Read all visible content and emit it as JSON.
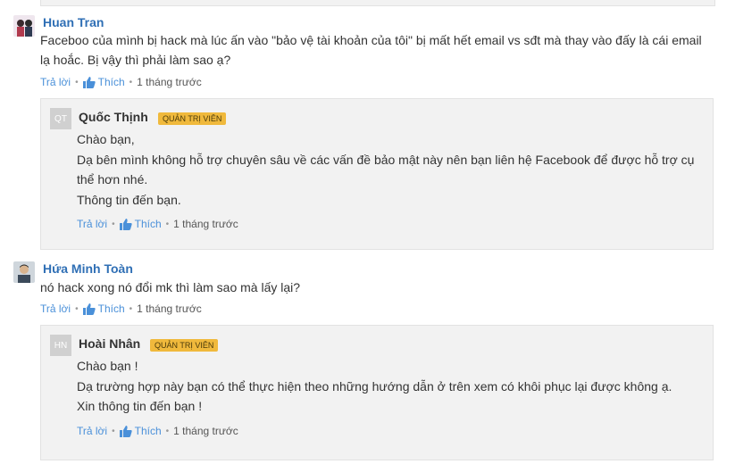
{
  "common": {
    "reply_label": "Trả lời",
    "like_label": "Thích",
    "separator": "•",
    "time_ago": "1 tháng trước",
    "badge_label": "QUẢN TRỊ VIÊN",
    "colors": {
      "author_link": "#2f6fb5",
      "action_link": "#4a90d9",
      "badge_bg": "#f0b93c",
      "reply_bg": "#f2f2f2"
    }
  },
  "comments": [
    {
      "author": "Huan Tran",
      "avatar_icon": "user-photo-avatar",
      "lines": [
        "Faceboo của mình bị hack mà lúc ấn vào \"bảo vệ tài khoản của tôi\" bị mất hết email vs sđt mà thay vào đấy là cái email",
        "lạ hoắc. Bị vậy thì phải làm sao ạ?"
      ],
      "reply": {
        "author": "Quốc Thịnh",
        "initials": "QT",
        "lines": [
          "Chào bạn,",
          "Dạ bên mình không hỗ trợ chuyên sâu về các vấn đề bảo mật này nên bạn liên hệ Facebook để được hỗ trợ cụ",
          "thể hơn nhé.",
          "Thông tin đến bạn."
        ]
      }
    },
    {
      "author": "Hứa Minh Toàn",
      "avatar_icon": "user-photo-avatar",
      "lines": [
        "nó hack xong nó đổi mk thì làm sao mà lấy lại?"
      ],
      "reply": {
        "author": "Hoài Nhân",
        "initials": "HN",
        "lines": [
          "Chào bạn !",
          "Dạ trường hợp này bạn có thể thực hiện theo những hướng dẫn ở trên xem có khôi phục lại được không ạ.",
          "Xin thông tin đến bạn !"
        ]
      }
    }
  ]
}
